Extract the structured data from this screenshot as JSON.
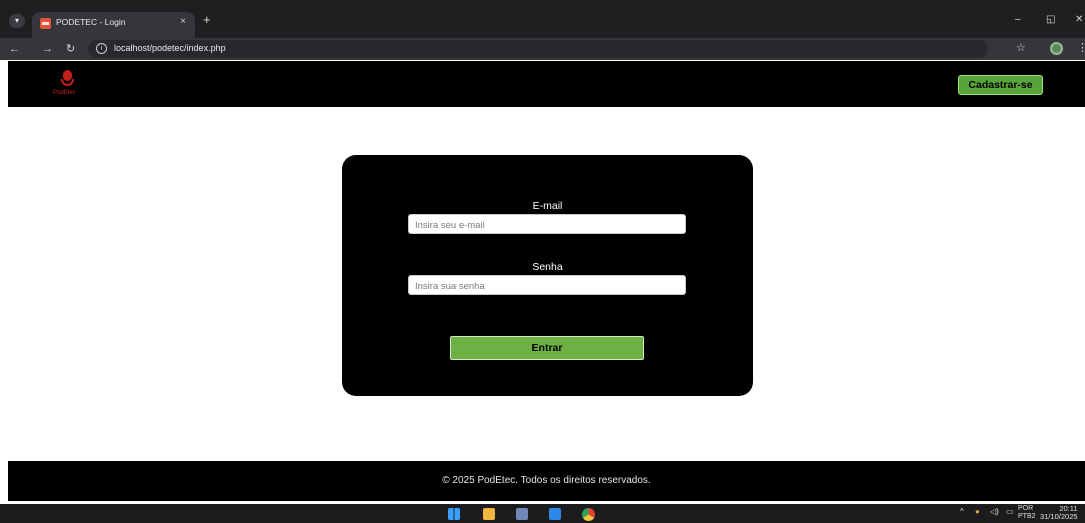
{
  "browser": {
    "tab_title": "PODETEC - Login",
    "tab_close": "×",
    "new_tab": "+",
    "url": "localhost/podetec/index.php",
    "window_minimize": "–",
    "window_restore": "◱",
    "window_close": "✕"
  },
  "header": {
    "logo_text": "PodEtec",
    "signup_label": "Cadastrar-se"
  },
  "login": {
    "email_label": "E-mail",
    "email_placeholder": "Insira seu e-mail",
    "email_value": "",
    "password_label": "Senha",
    "password_placeholder": "Insira sua senha",
    "password_value": "",
    "submit_label": "Entrar"
  },
  "footer": {
    "copyright": "© 2025 PodEtec. Todos os direitos reservados."
  },
  "taskbar": {
    "language_top": "POR",
    "language_bottom": "PTB2",
    "time": "20:11",
    "date": "31/10/2025"
  },
  "colors": {
    "header_bg": "#000000",
    "accent_green": "#6db146",
    "logo_red": "#c21e1e"
  },
  "icons": [
    "tab-menu-icon",
    "favicon-icon",
    "back-icon",
    "forward-icon",
    "reload-icon",
    "info-icon",
    "star-icon",
    "extension-icon",
    "menu-kebab-icon",
    "microphone-logo-icon",
    "windows-start-icon",
    "file-explorer-icon",
    "store-icon",
    "app-icon",
    "chrome-icon"
  ]
}
